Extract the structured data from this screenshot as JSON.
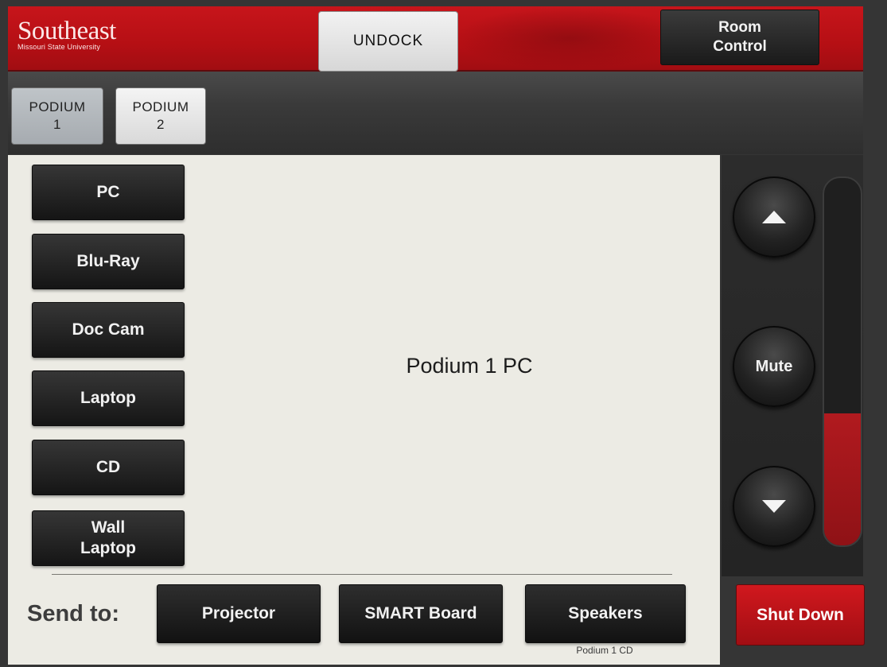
{
  "header": {
    "logo_name": "Southeast",
    "logo_subtitle": "Missouri State University",
    "undock_label": "UNDOCK",
    "room_control_label": "Room Control"
  },
  "podium_tabs": [
    {
      "label": "PODIUM 1",
      "active": true
    },
    {
      "label": "PODIUM 2",
      "active": false
    }
  ],
  "sources": [
    {
      "label": "PC"
    },
    {
      "label": "Blu-Ray"
    },
    {
      "label": "Doc Cam"
    },
    {
      "label": "Laptop"
    },
    {
      "label": "CD"
    },
    {
      "label": "Wall Laptop"
    }
  ],
  "display": {
    "current_source": "Podium 1 PC"
  },
  "send_to": {
    "label": "Send to:",
    "destinations": [
      {
        "label": "Projector"
      },
      {
        "label": "SMART Board"
      },
      {
        "label": "Speakers",
        "status": "Podium 1 CD"
      }
    ]
  },
  "volume": {
    "up_icon": "volume-up-icon",
    "down_icon": "volume-down-icon",
    "mute_label": "Mute",
    "level_percent": 36
  },
  "shutdown_label": "Shut Down",
  "colors": {
    "brand_red": "#c7151b",
    "panel_bg": "#ecebe4",
    "button_dark": "#1a1a1a"
  }
}
